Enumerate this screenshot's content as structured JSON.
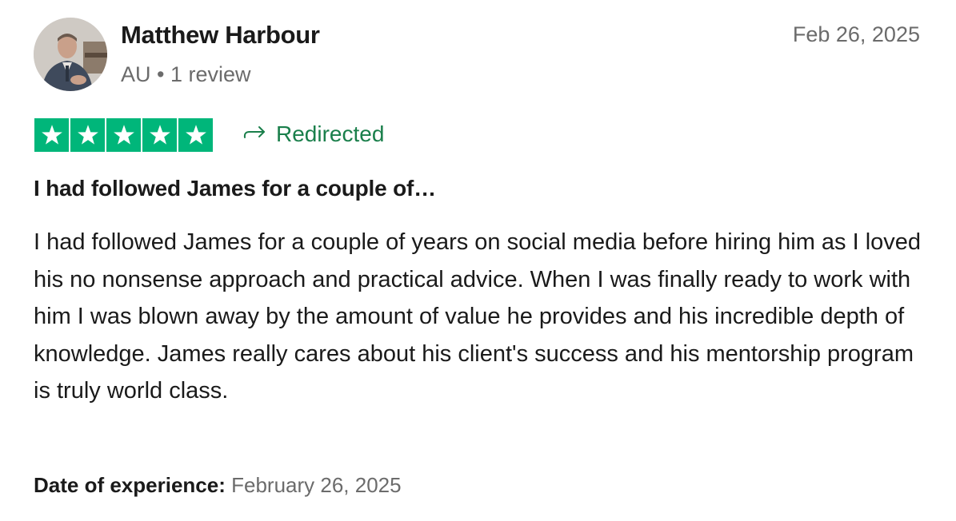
{
  "reviewer": {
    "name": "Matthew Harbour",
    "country": "AU",
    "separator": "•",
    "review_count": "1 review"
  },
  "review": {
    "date": "Feb 26, 2025",
    "rating": 5,
    "rating_max": 5,
    "star_color": "#00b67a",
    "badge_label": "Redirected",
    "badge_color": "#1a7f4b",
    "title": "I had followed James for a couple of…",
    "body": "I had followed James for a couple of years on social media before hiring him as I loved his no nonsense approach and practical advice. When I was finally ready to work with him I was blown away by the amount of value he provides and his incredible depth of knowledge. James really cares about his client's success and his mentorship program is truly world class.",
    "experience_label": "Date of experience:",
    "experience_date": "February 26, 2025"
  }
}
